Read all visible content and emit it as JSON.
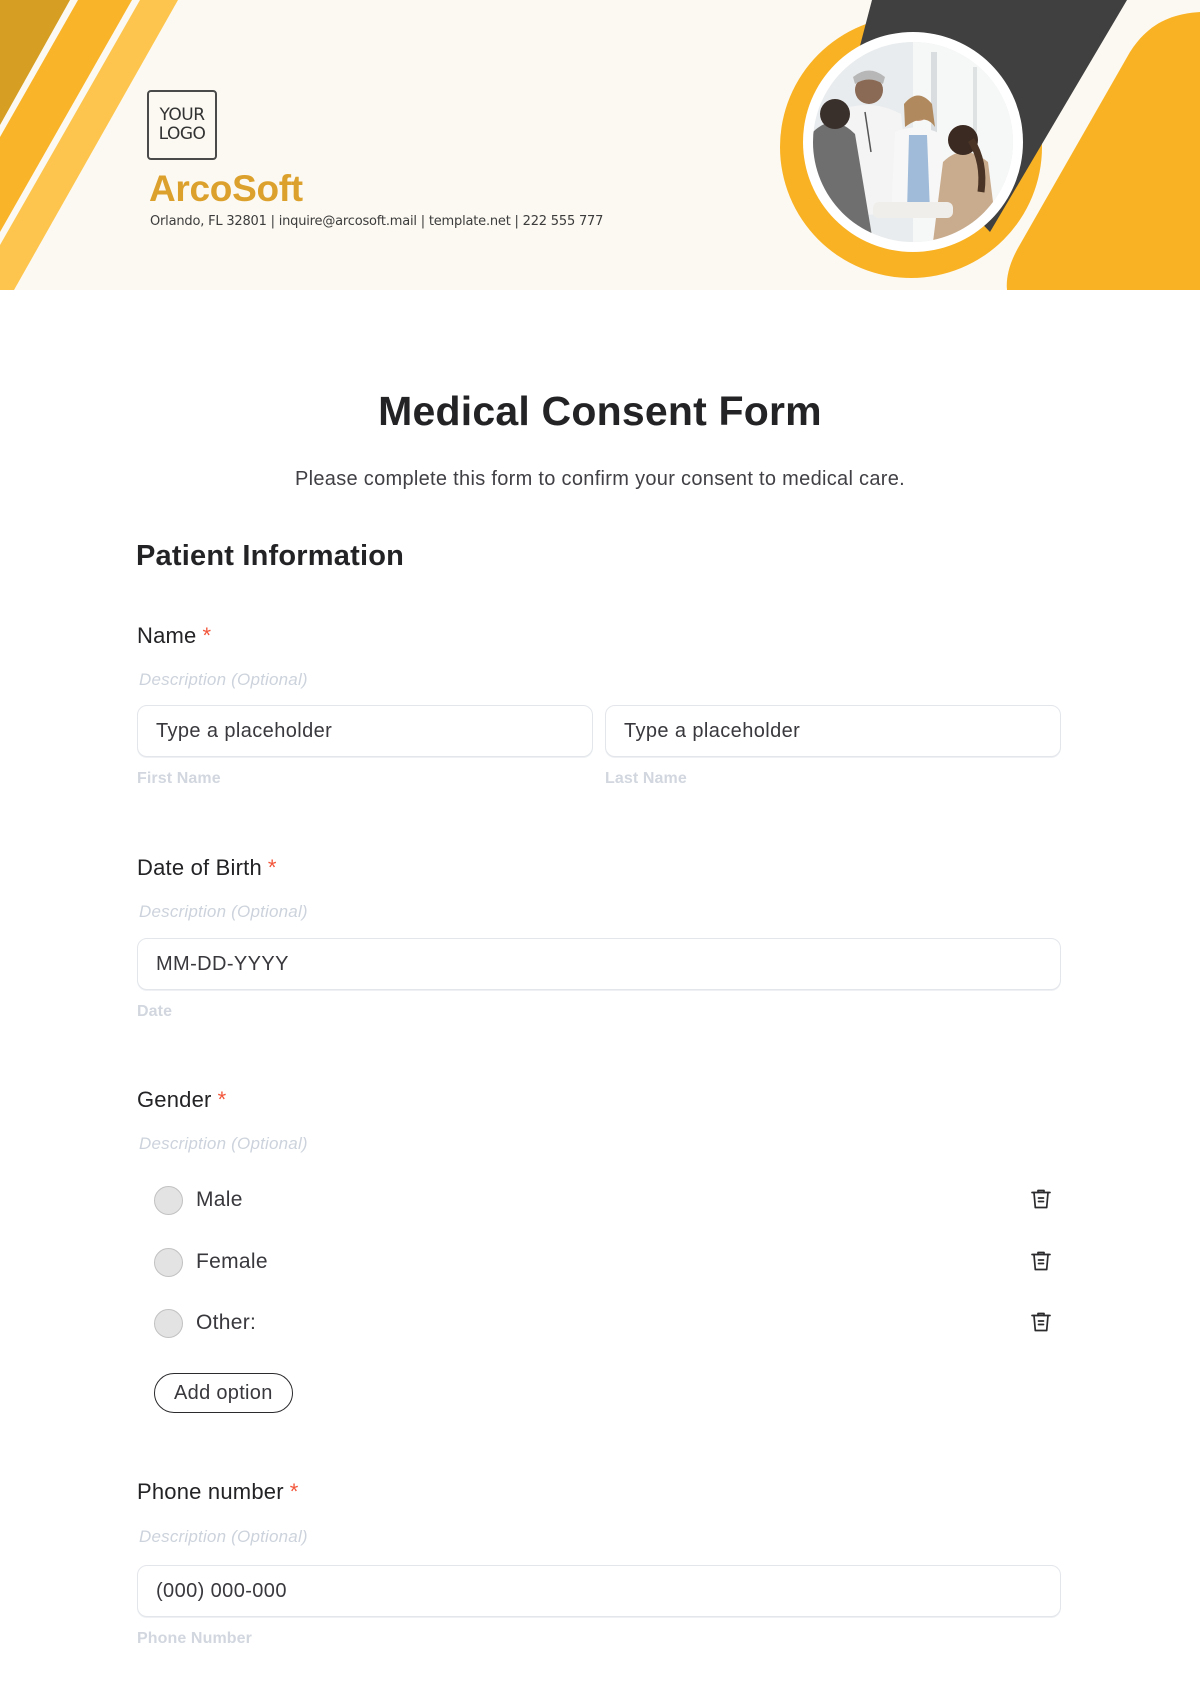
{
  "header": {
    "logo_line1": "YOUR",
    "logo_line2": "LOGO",
    "company_name": "ArcoSoft",
    "contact_line": "Orlando, FL 32801 | inquire@arcosoft.mail | template.net | 222 555 777",
    "photo_alt": "Doctors greeting patients in a clinic",
    "colors": {
      "stripe_dark": "#d69e22",
      "stripe_mid": "#f9b42a",
      "stripe_light": "#fdc54d",
      "accent_orange": "#f9b224",
      "band_dark": "#404040",
      "background": "#fcf9f2",
      "company_name": "#dca12c"
    }
  },
  "form": {
    "title": "Medical Consent Form",
    "subtitle": "Please complete this form to confirm your consent to medical care.",
    "section_title": "Patient Information",
    "required_marker": "*",
    "fields": {
      "name": {
        "label": "Name",
        "description": "Description (Optional)",
        "first_placeholder": "Type a placeholder",
        "last_placeholder": "Type a placeholder",
        "first_caption": "First Name",
        "last_caption": "Last Name"
      },
      "dob": {
        "label": "Date of Birth",
        "description": "Description (Optional)",
        "placeholder": "MM-DD-YYYY",
        "caption": "Date"
      },
      "gender": {
        "label": "Gender",
        "description": "Description (Optional)",
        "options": [
          {
            "label": "Male",
            "selected": false,
            "icon": "trash-icon"
          },
          {
            "label": "Female",
            "selected": false,
            "icon": "trash-icon"
          },
          {
            "label": "Other:",
            "selected": false,
            "icon": "trash-icon"
          }
        ],
        "add_option_label": "Add option"
      },
      "phone": {
        "label": "Phone number",
        "description": "Description (Optional)",
        "placeholder": "(000) 000-000",
        "caption": "Phone Number"
      }
    },
    "colors": {
      "required": "#f2553a",
      "description": "#cdd3dc",
      "caption": "#d2d7df",
      "input_border": "#e3e6eb"
    }
  }
}
